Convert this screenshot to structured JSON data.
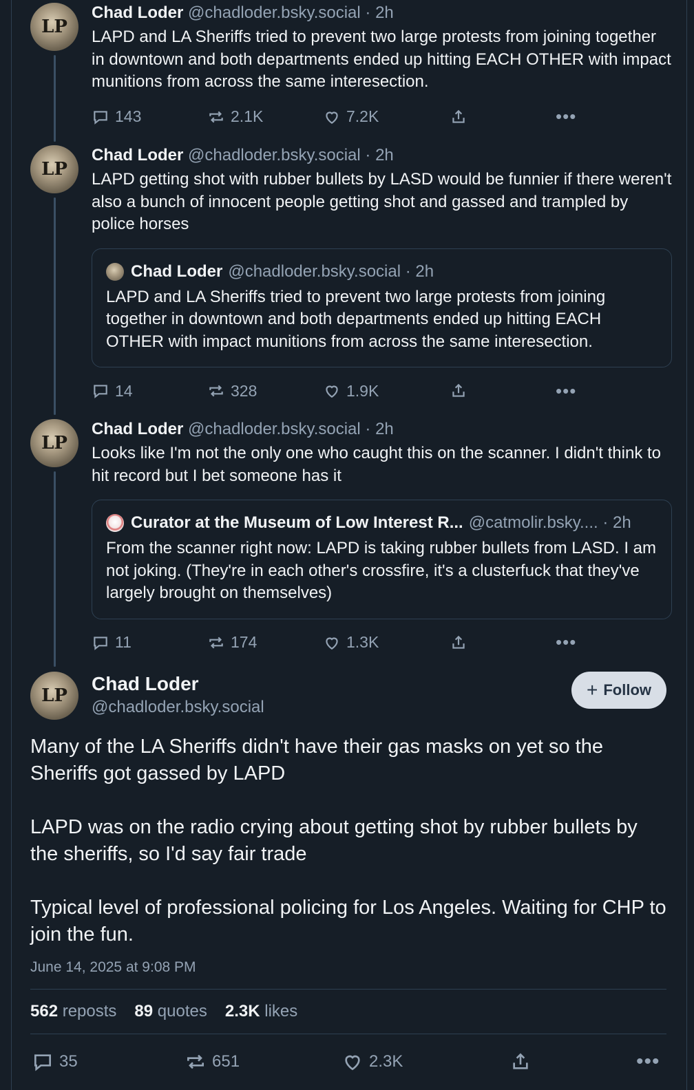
{
  "thread": [
    {
      "author": "Chad Loder",
      "handle": "@chadloder.bsky.social",
      "time": "· 2h",
      "text": "LAPD and LA Sheriffs tried to prevent two large protests from joining together in downtown and both departments ended up hitting EACH OTHER with impact munitions from across the same interesection.",
      "replies": "143",
      "reposts": "2.1K",
      "likes": "7.2K"
    },
    {
      "author": "Chad Loder",
      "handle": "@chadloder.bsky.social",
      "time": "· 2h",
      "text": "LAPD getting shot with rubber bullets by LASD would be funnier if there weren't also a bunch of innocent people getting shot and gassed and trampled by police horses",
      "quote": {
        "author": "Chad Loder",
        "handle": "@chadloder.bsky.social",
        "time": "· 2h",
        "text": "LAPD and LA Sheriffs tried to prevent two large protests from joining together in downtown and both departments ended up hitting EACH OTHER with impact munitions from across the same interesection."
      },
      "replies": "14",
      "reposts": "328",
      "likes": "1.9K"
    },
    {
      "author": "Chad Loder",
      "handle": "@chadloder.bsky.social",
      "time": "· 2h",
      "text": "Looks like I'm not the only one who caught this on the scanner. I didn't think to hit record but I bet someone has it",
      "quote": {
        "author": "Curator at the Museum of Low Interest R...",
        "handle": "@catmolir.bsky....",
        "time": "· 2h",
        "text": "From the scanner right now: LAPD is taking rubber bullets from LASD. I am not joking. (They're in each other's crossfire, it's a clusterfuck that they've largely brought on themselves)"
      },
      "replies": "11",
      "reposts": "174",
      "likes": "1.3K"
    }
  ],
  "main": {
    "author": "Chad Loder",
    "handle": "@chadloder.bsky.social",
    "follow_label": "Follow",
    "paragraphs": [
      "Many of the LA Sheriffs didn't have their gas masks on yet so the Sheriffs got gassed by LAPD",
      "LAPD was on the radio crying about getting shot by  rubber bullets by the sheriffs, so I'd say fair trade",
      "Typical level of professional policing for Los Angeles. Waiting for CHP to join the fun."
    ],
    "timestamp": "June 14, 2025 at 9:08 PM",
    "stats": {
      "reposts_count": "562",
      "reposts_label": "reposts",
      "quotes_count": "89",
      "quotes_label": "quotes",
      "likes_count": "2.3K",
      "likes_label": "likes"
    },
    "replies": "35",
    "reposts": "651",
    "likes": "2.3K"
  },
  "avatar_glyph": "LP",
  "icons": {
    "reply": "reply-icon",
    "repost": "repost-icon",
    "like": "heart-icon",
    "share": "share-icon",
    "more": "more-icon",
    "follow": "plus-icon"
  }
}
